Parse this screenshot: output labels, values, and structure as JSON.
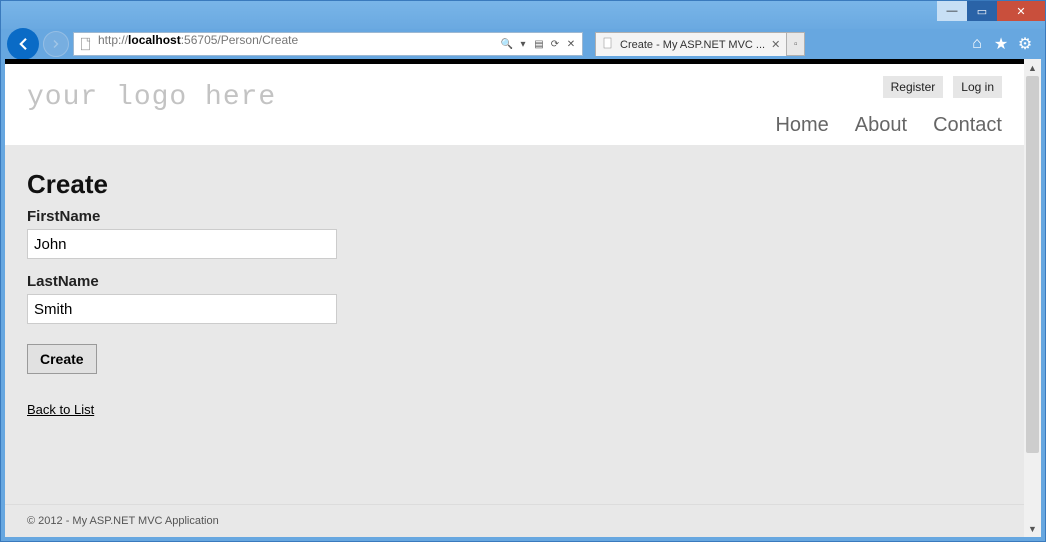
{
  "window": {
    "minimize": "—",
    "maximize": "▭",
    "close": "✕"
  },
  "browser": {
    "url_proto": "http://",
    "url_host": "localhost",
    "url_port_path": ":56705/Person/Create",
    "search_glyph": "🔍",
    "dropdown_glyph": "▾",
    "refresh_glyph": "⟳",
    "stop_glyph": "✕",
    "tab_title": "Create - My ASP.NET MVC ...",
    "tab_close": "✕",
    "newtab": "▫",
    "home_glyph": "⌂",
    "star_glyph": "★",
    "gear_glyph": "⚙",
    "compat_glyph": "▤"
  },
  "page": {
    "logo": "your logo here",
    "account": {
      "register": "Register",
      "login": "Log in"
    },
    "nav": {
      "home": "Home",
      "about": "About",
      "contact": "Contact"
    },
    "title": "Create",
    "fields": {
      "first_label": "FirstName",
      "first_value": "John",
      "last_label": "LastName",
      "last_value": "Smith"
    },
    "submit": "Create",
    "back": "Back to List",
    "footer": "© 2012 - My ASP.NET MVC Application"
  },
  "scrollbar": {
    "up": "▲",
    "down": "▼"
  }
}
